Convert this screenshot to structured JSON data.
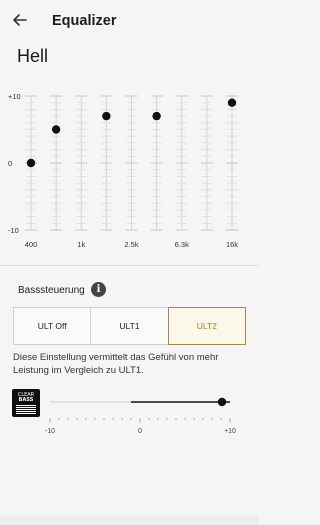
{
  "header": {
    "title": "Equalizer",
    "back_icon": "arrow-left-icon"
  },
  "preset": {
    "name": "Hell"
  },
  "equalizer": {
    "scale_labels": [
      "+10",
      "0",
      "-10"
    ],
    "bands": [
      {
        "freq": "400",
        "value": 0
      },
      {
        "freq": "",
        "value": 5
      },
      {
        "freq": "1k",
        "value": 0
      },
      {
        "freq": "",
        "value": 7
      },
      {
        "freq": "2.5k",
        "value": 0
      },
      {
        "freq": "",
        "value": 7
      },
      {
        "freq": "6.3k",
        "value": 0
      },
      {
        "freq": "",
        "value": 0
      },
      {
        "freq": "16k",
        "value": 9
      }
    ],
    "handle_indices": [
      0,
      1,
      3,
      5,
      8
    ],
    "label_indices": [
      0,
      2,
      4,
      6,
      8
    ]
  },
  "bass": {
    "label": "Basssteuerung",
    "info_icon": "info-icon",
    "options": [
      "ULT Off",
      "ULT1",
      "ULT2"
    ],
    "selected": "ULT2",
    "selected_color": "#9b7e2c",
    "description": "Diese Einstellung vermittelt das Gefühl von mehr Leistung im Vergleich zu ULT1."
  },
  "clear_bass": {
    "logo_text_top": "CLEAR",
    "logo_text_bottom": "BASS",
    "min_label": "-10",
    "mid_label": "0",
    "max_label": "+10",
    "value": 10
  }
}
